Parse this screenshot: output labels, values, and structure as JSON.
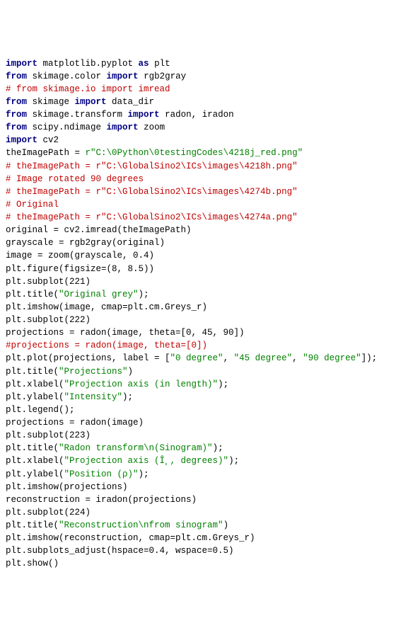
{
  "code": {
    "lines": [
      {
        "segments": [
          {
            "t": "import",
            "c": "kw"
          },
          {
            "t": " matplotlib.pyplot ",
            "c": "mod"
          },
          {
            "t": "as",
            "c": "kw"
          },
          {
            "t": " plt",
            "c": "mod"
          }
        ]
      },
      {
        "segments": [
          {
            "t": "from",
            "c": "kw"
          },
          {
            "t": " skimage.color ",
            "c": "mod"
          },
          {
            "t": "import",
            "c": "kw"
          },
          {
            "t": " rgb2gray",
            "c": "mod"
          }
        ]
      },
      {
        "segments": [
          {
            "t": "# from skimage.io import imread",
            "c": "cmt"
          }
        ]
      },
      {
        "segments": [
          {
            "t": "from",
            "c": "kw"
          },
          {
            "t": " skimage ",
            "c": "mod"
          },
          {
            "t": "import",
            "c": "kw"
          },
          {
            "t": " data_dir",
            "c": "mod"
          }
        ]
      },
      {
        "segments": [
          {
            "t": "from",
            "c": "kw"
          },
          {
            "t": " skimage.transform ",
            "c": "mod"
          },
          {
            "t": "import",
            "c": "kw"
          },
          {
            "t": " radon, iradon",
            "c": "mod"
          }
        ]
      },
      {
        "segments": [
          {
            "t": "from",
            "c": "kw"
          },
          {
            "t": " scipy.ndimage ",
            "c": "mod"
          },
          {
            "t": "import",
            "c": "kw"
          },
          {
            "t": " zoom",
            "c": "mod"
          }
        ]
      },
      {
        "segments": [
          {
            "t": "import",
            "c": "kw"
          },
          {
            "t": " cv2",
            "c": "mod"
          }
        ]
      },
      {
        "segments": [
          {
            "t": "",
            "c": "mod"
          }
        ]
      },
      {
        "segments": [
          {
            "t": "theImagePath = ",
            "c": "mod"
          },
          {
            "t": "r\"C:\\0Python\\0testingCodes\\4218j_red.png\"",
            "c": "str"
          }
        ]
      },
      {
        "segments": [
          {
            "t": "# theImagePath = r\"C:\\GlobalSino2\\ICs\\images\\4218h.png\"",
            "c": "cmt"
          }
        ]
      },
      {
        "segments": [
          {
            "t": "# Image rotated 90 degrees",
            "c": "cmt"
          }
        ]
      },
      {
        "segments": [
          {
            "t": "# theImagePath = r\"C:\\GlobalSino2\\ICs\\images\\4274b.png\"",
            "c": "cmt"
          }
        ]
      },
      {
        "segments": [
          {
            "t": "# Original",
            "c": "cmt"
          }
        ]
      },
      {
        "segments": [
          {
            "t": "# theImagePath = r\"C:\\GlobalSino2\\ICs\\images\\4274a.png\"",
            "c": "cmt"
          }
        ]
      },
      {
        "segments": [
          {
            "t": "",
            "c": "mod"
          }
        ]
      },
      {
        "segments": [
          {
            "t": "original = cv2.imread(theImagePath)",
            "c": "mod"
          }
        ]
      },
      {
        "segments": [
          {
            "t": "grayscale = rgb2gray(original)",
            "c": "mod"
          }
        ]
      },
      {
        "segments": [
          {
            "t": "",
            "c": "mod"
          }
        ]
      },
      {
        "segments": [
          {
            "t": "image = zoom(grayscale, 0.4)",
            "c": "mod"
          }
        ]
      },
      {
        "segments": [
          {
            "t": "plt.figure(figsize=(8, 8.5))",
            "c": "mod"
          }
        ]
      },
      {
        "segments": [
          {
            "t": "",
            "c": "mod"
          }
        ]
      },
      {
        "segments": [
          {
            "t": "plt.subplot(221)",
            "c": "mod"
          }
        ]
      },
      {
        "segments": [
          {
            "t": "plt.title(",
            "c": "mod"
          },
          {
            "t": "\"Original grey\"",
            "c": "str"
          },
          {
            "t": ");",
            "c": "mod"
          }
        ]
      },
      {
        "segments": [
          {
            "t": "plt.imshow(image, cmap=plt.cm.Greys_r)",
            "c": "mod"
          }
        ]
      },
      {
        "segments": [
          {
            "t": "",
            "c": "mod"
          }
        ]
      },
      {
        "segments": [
          {
            "t": "plt.subplot(222)",
            "c": "mod"
          }
        ]
      },
      {
        "segments": [
          {
            "t": "projections = radon(image, theta=[0, 45, 90])",
            "c": "mod"
          }
        ]
      },
      {
        "segments": [
          {
            "t": "#projections = radon(image, theta=[0])",
            "c": "cmt"
          }
        ]
      },
      {
        "segments": [
          {
            "t": "plt.plot(projections, label = [",
            "c": "mod"
          },
          {
            "t": "\"0 degree\"",
            "c": "str"
          },
          {
            "t": ", ",
            "c": "mod"
          },
          {
            "t": "\"45 degree\"",
            "c": "str"
          },
          {
            "t": ", ",
            "c": "mod"
          },
          {
            "t": "\"90 degree\"",
            "c": "str"
          },
          {
            "t": "]);",
            "c": "mod"
          }
        ]
      },
      {
        "segments": [
          {
            "t": "plt.title(",
            "c": "mod"
          },
          {
            "t": "\"Projections\"",
            "c": "str"
          },
          {
            "t": ")",
            "c": "mod"
          }
        ]
      },
      {
        "segments": [
          {
            "t": "plt.xlabel(",
            "c": "mod"
          },
          {
            "t": "\"Projection axis (in length)\"",
            "c": "str"
          },
          {
            "t": ");",
            "c": "mod"
          }
        ]
      },
      {
        "segments": [
          {
            "t": "plt.ylabel(",
            "c": "mod"
          },
          {
            "t": "\"Intensity\"",
            "c": "str"
          },
          {
            "t": ");",
            "c": "mod"
          }
        ]
      },
      {
        "segments": [
          {
            "t": "plt.legend();",
            "c": "mod"
          }
        ]
      },
      {
        "segments": [
          {
            "t": "",
            "c": "mod"
          }
        ]
      },
      {
        "segments": [
          {
            "t": "projections = radon(image)",
            "c": "mod"
          }
        ]
      },
      {
        "segments": [
          {
            "t": "plt.subplot(223)",
            "c": "mod"
          }
        ]
      },
      {
        "segments": [
          {
            "t": "plt.title(",
            "c": "mod"
          },
          {
            "t": "\"Radon transform\\n(Sinogram)\"",
            "c": "str"
          },
          {
            "t": ");",
            "c": "mod"
          }
        ]
      },
      {
        "segments": [
          {
            "t": "plt.xlabel(",
            "c": "mod"
          },
          {
            "t": "\"Projection axis (Î¸, degrees)\"",
            "c": "str"
          },
          {
            "t": ");",
            "c": "mod"
          }
        ]
      },
      {
        "segments": [
          {
            "t": "plt.ylabel(",
            "c": "mod"
          },
          {
            "t": "\"Position (ρ)\"",
            "c": "str"
          },
          {
            "t": ");",
            "c": "mod"
          }
        ]
      },
      {
        "segments": [
          {
            "t": "plt.imshow(projections)",
            "c": "mod"
          }
        ]
      },
      {
        "segments": [
          {
            "t": "",
            "c": "mod"
          }
        ]
      },
      {
        "segments": [
          {
            "t": "reconstruction = iradon(projections)",
            "c": "mod"
          }
        ]
      },
      {
        "segments": [
          {
            "t": "plt.subplot(224)",
            "c": "mod"
          }
        ]
      },
      {
        "segments": [
          {
            "t": "plt.title(",
            "c": "mod"
          },
          {
            "t": "\"Reconstruction\\nfrom sinogram\"",
            "c": "str"
          },
          {
            "t": ")",
            "c": "mod"
          }
        ]
      },
      {
        "segments": [
          {
            "t": "plt.imshow(reconstruction, cmap=plt.cm.Greys_r)",
            "c": "mod"
          }
        ]
      },
      {
        "segments": [
          {
            "t": "",
            "c": "mod"
          }
        ]
      },
      {
        "segments": [
          {
            "t": "plt.subplots_adjust(hspace=0.4, wspace=0.5)",
            "c": "mod"
          }
        ]
      },
      {
        "segments": [
          {
            "t": "plt.show()",
            "c": "mod"
          }
        ]
      }
    ]
  }
}
